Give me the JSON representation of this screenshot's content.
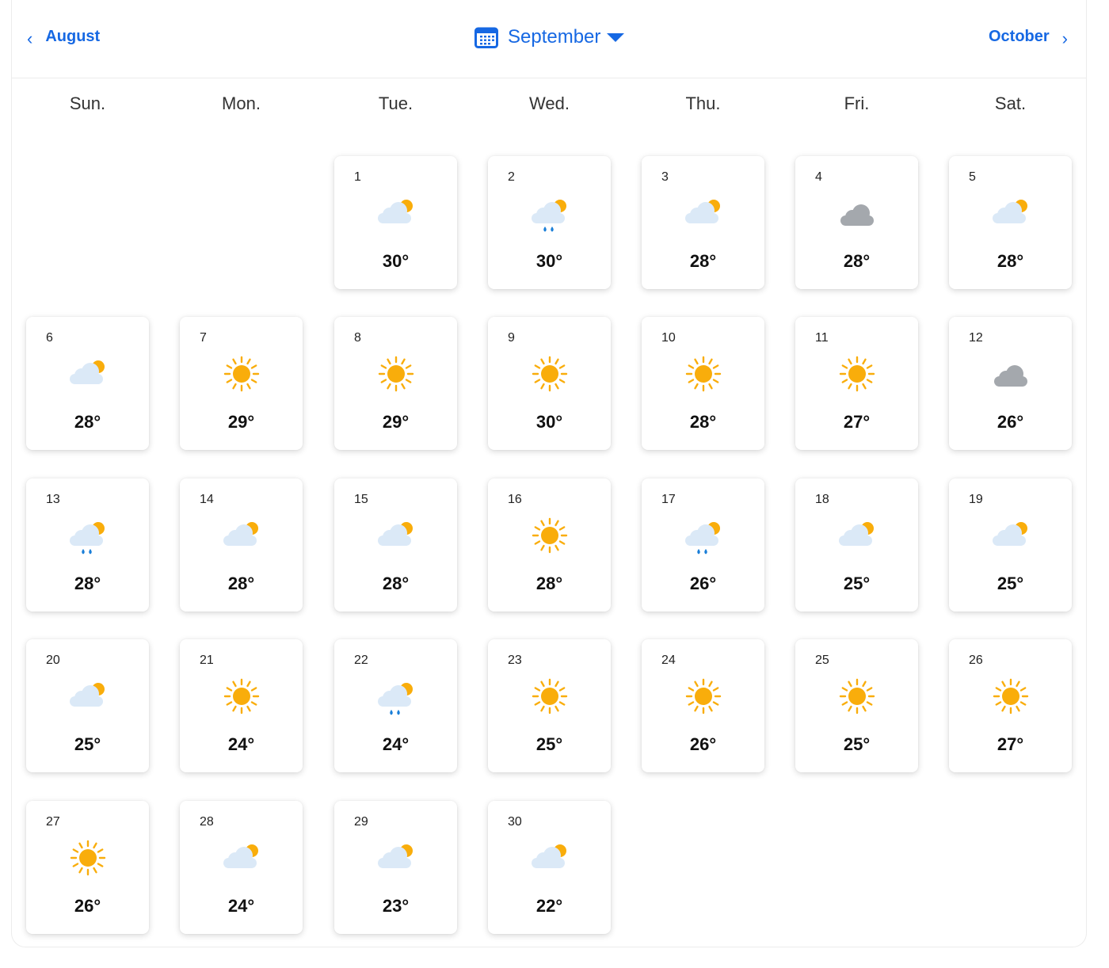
{
  "header": {
    "prev_label": "August",
    "current_label": "September",
    "next_label": "October"
  },
  "weekdays": [
    "Sun.",
    "Mon.",
    "Tue.",
    "Wed.",
    "Thu.",
    "Fri.",
    "Sat."
  ],
  "first_weekday_index": 2,
  "colors": {
    "accent": "#1668e3",
    "sun": "#f9ad0b",
    "cloud": "#dbe9f7",
    "overcast": "#a4a8ad",
    "rain": "#1a7fd8"
  },
  "days": [
    {
      "day": "1",
      "temp": "30°",
      "icon": "partly-cloudy"
    },
    {
      "day": "2",
      "temp": "30°",
      "icon": "partly-cloudy-rain"
    },
    {
      "day": "3",
      "temp": "28°",
      "icon": "partly-cloudy"
    },
    {
      "day": "4",
      "temp": "28°",
      "icon": "cloudy"
    },
    {
      "day": "5",
      "temp": "28°",
      "icon": "partly-cloudy"
    },
    {
      "day": "6",
      "temp": "28°",
      "icon": "partly-cloudy"
    },
    {
      "day": "7",
      "temp": "29°",
      "icon": "sunny"
    },
    {
      "day": "8",
      "temp": "29°",
      "icon": "sunny"
    },
    {
      "day": "9",
      "temp": "30°",
      "icon": "sunny"
    },
    {
      "day": "10",
      "temp": "28°",
      "icon": "sunny"
    },
    {
      "day": "11",
      "temp": "27°",
      "icon": "sunny"
    },
    {
      "day": "12",
      "temp": "26°",
      "icon": "cloudy"
    },
    {
      "day": "13",
      "temp": "28°",
      "icon": "partly-cloudy-rain"
    },
    {
      "day": "14",
      "temp": "28°",
      "icon": "partly-cloudy"
    },
    {
      "day": "15",
      "temp": "28°",
      "icon": "partly-cloudy"
    },
    {
      "day": "16",
      "temp": "28°",
      "icon": "sunny"
    },
    {
      "day": "17",
      "temp": "26°",
      "icon": "partly-cloudy-rain"
    },
    {
      "day": "18",
      "temp": "25°",
      "icon": "partly-cloudy"
    },
    {
      "day": "19",
      "temp": "25°",
      "icon": "partly-cloudy"
    },
    {
      "day": "20",
      "temp": "25°",
      "icon": "partly-cloudy"
    },
    {
      "day": "21",
      "temp": "24°",
      "icon": "sunny"
    },
    {
      "day": "22",
      "temp": "24°",
      "icon": "partly-cloudy-rain"
    },
    {
      "day": "23",
      "temp": "25°",
      "icon": "sunny"
    },
    {
      "day": "24",
      "temp": "26°",
      "icon": "sunny"
    },
    {
      "day": "25",
      "temp": "25°",
      "icon": "sunny"
    },
    {
      "day": "26",
      "temp": "27°",
      "icon": "sunny"
    },
    {
      "day": "27",
      "temp": "26°",
      "icon": "sunny"
    },
    {
      "day": "28",
      "temp": "24°",
      "icon": "partly-cloudy"
    },
    {
      "day": "29",
      "temp": "23°",
      "icon": "partly-cloudy"
    },
    {
      "day": "30",
      "temp": "22°",
      "icon": "partly-cloudy"
    }
  ]
}
